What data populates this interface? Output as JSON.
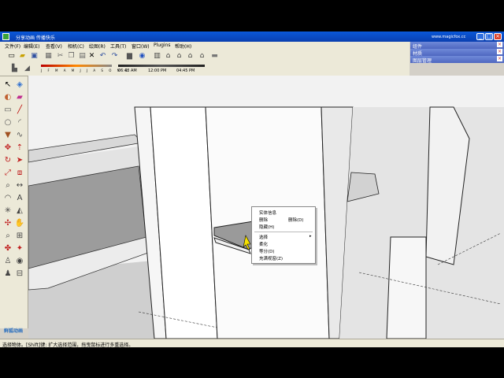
{
  "window": {
    "title": "分享动画 传播快乐",
    "site": "www.magicfox.cc"
  },
  "menu": [
    "文件(F)",
    "编辑(E)",
    "查看(V)",
    "相机(C)",
    "绘图(R)",
    "工具(T)",
    "窗口(W)",
    "Plugins",
    "帮助(H)"
  ],
  "right_panel": {
    "items": [
      "组件",
      "材质",
      "图层管理"
    ]
  },
  "shadow_toolbar": {
    "months": "J F M A M J J A S O N D",
    "time_start": "06:43 AM",
    "time_mid": "12:00 PM",
    "time_end": "04:45 PM"
  },
  "context_menu": {
    "items": [
      {
        "label": "实体信息"
      },
      {
        "label": "删除",
        "shortcut": "删除(D)"
      },
      {
        "label": "隐藏(H)"
      },
      {
        "label": "选择"
      },
      {
        "label": "柔化"
      },
      {
        "label": "等分(D)"
      },
      {
        "label": "充满视窗(Z)"
      }
    ]
  },
  "status": {
    "text": "选择物体。[Shift]键: 扩大选择范围，拖曳鼠标进行多重选择。"
  },
  "watermark": "鲜狐动画",
  "colors": {
    "title_blue": "#0a58d8",
    "panel_blue": "#5b74c8",
    "toolbar": "#ece9d8",
    "viewport_bg": "#f2f2f2"
  }
}
